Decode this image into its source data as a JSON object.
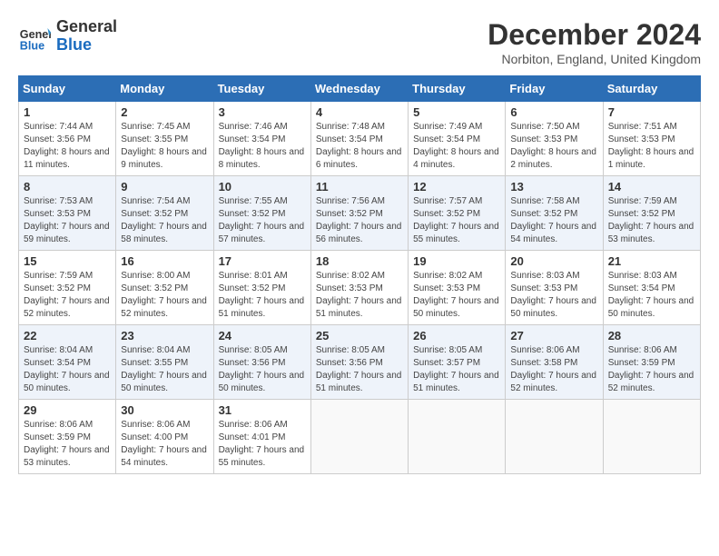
{
  "logo": {
    "text_general": "General",
    "text_blue": "Blue"
  },
  "header": {
    "title": "December 2024",
    "location": "Norbiton, England, United Kingdom"
  },
  "weekdays": [
    "Sunday",
    "Monday",
    "Tuesday",
    "Wednesday",
    "Thursday",
    "Friday",
    "Saturday"
  ],
  "weeks": [
    [
      {
        "day": "1",
        "sunrise": "7:44 AM",
        "sunset": "3:56 PM",
        "daylight": "8 hours and 11 minutes."
      },
      {
        "day": "2",
        "sunrise": "7:45 AM",
        "sunset": "3:55 PM",
        "daylight": "8 hours and 9 minutes."
      },
      {
        "day": "3",
        "sunrise": "7:46 AM",
        "sunset": "3:54 PM",
        "daylight": "8 hours and 8 minutes."
      },
      {
        "day": "4",
        "sunrise": "7:48 AM",
        "sunset": "3:54 PM",
        "daylight": "8 hours and 6 minutes."
      },
      {
        "day": "5",
        "sunrise": "7:49 AM",
        "sunset": "3:54 PM",
        "daylight": "8 hours and 4 minutes."
      },
      {
        "day": "6",
        "sunrise": "7:50 AM",
        "sunset": "3:53 PM",
        "daylight": "8 hours and 2 minutes."
      },
      {
        "day": "7",
        "sunrise": "7:51 AM",
        "sunset": "3:53 PM",
        "daylight": "8 hours and 1 minute."
      }
    ],
    [
      {
        "day": "8",
        "sunrise": "7:53 AM",
        "sunset": "3:53 PM",
        "daylight": "7 hours and 59 minutes."
      },
      {
        "day": "9",
        "sunrise": "7:54 AM",
        "sunset": "3:52 PM",
        "daylight": "7 hours and 58 minutes."
      },
      {
        "day": "10",
        "sunrise": "7:55 AM",
        "sunset": "3:52 PM",
        "daylight": "7 hours and 57 minutes."
      },
      {
        "day": "11",
        "sunrise": "7:56 AM",
        "sunset": "3:52 PM",
        "daylight": "7 hours and 56 minutes."
      },
      {
        "day": "12",
        "sunrise": "7:57 AM",
        "sunset": "3:52 PM",
        "daylight": "7 hours and 55 minutes."
      },
      {
        "day": "13",
        "sunrise": "7:58 AM",
        "sunset": "3:52 PM",
        "daylight": "7 hours and 54 minutes."
      },
      {
        "day": "14",
        "sunrise": "7:59 AM",
        "sunset": "3:52 PM",
        "daylight": "7 hours and 53 minutes."
      }
    ],
    [
      {
        "day": "15",
        "sunrise": "7:59 AM",
        "sunset": "3:52 PM",
        "daylight": "7 hours and 52 minutes."
      },
      {
        "day": "16",
        "sunrise": "8:00 AM",
        "sunset": "3:52 PM",
        "daylight": "7 hours and 52 minutes."
      },
      {
        "day": "17",
        "sunrise": "8:01 AM",
        "sunset": "3:52 PM",
        "daylight": "7 hours and 51 minutes."
      },
      {
        "day": "18",
        "sunrise": "8:02 AM",
        "sunset": "3:53 PM",
        "daylight": "7 hours and 51 minutes."
      },
      {
        "day": "19",
        "sunrise": "8:02 AM",
        "sunset": "3:53 PM",
        "daylight": "7 hours and 50 minutes."
      },
      {
        "day": "20",
        "sunrise": "8:03 AM",
        "sunset": "3:53 PM",
        "daylight": "7 hours and 50 minutes."
      },
      {
        "day": "21",
        "sunrise": "8:03 AM",
        "sunset": "3:54 PM",
        "daylight": "7 hours and 50 minutes."
      }
    ],
    [
      {
        "day": "22",
        "sunrise": "8:04 AM",
        "sunset": "3:54 PM",
        "daylight": "7 hours and 50 minutes."
      },
      {
        "day": "23",
        "sunrise": "8:04 AM",
        "sunset": "3:55 PM",
        "daylight": "7 hours and 50 minutes."
      },
      {
        "day": "24",
        "sunrise": "8:05 AM",
        "sunset": "3:56 PM",
        "daylight": "7 hours and 50 minutes."
      },
      {
        "day": "25",
        "sunrise": "8:05 AM",
        "sunset": "3:56 PM",
        "daylight": "7 hours and 51 minutes."
      },
      {
        "day": "26",
        "sunrise": "8:05 AM",
        "sunset": "3:57 PM",
        "daylight": "7 hours and 51 minutes."
      },
      {
        "day": "27",
        "sunrise": "8:06 AM",
        "sunset": "3:58 PM",
        "daylight": "7 hours and 52 minutes."
      },
      {
        "day": "28",
        "sunrise": "8:06 AM",
        "sunset": "3:59 PM",
        "daylight": "7 hours and 52 minutes."
      }
    ],
    [
      {
        "day": "29",
        "sunrise": "8:06 AM",
        "sunset": "3:59 PM",
        "daylight": "7 hours and 53 minutes."
      },
      {
        "day": "30",
        "sunrise": "8:06 AM",
        "sunset": "4:00 PM",
        "daylight": "7 hours and 54 minutes."
      },
      {
        "day": "31",
        "sunrise": "8:06 AM",
        "sunset": "4:01 PM",
        "daylight": "7 hours and 55 minutes."
      },
      null,
      null,
      null,
      null
    ]
  ]
}
